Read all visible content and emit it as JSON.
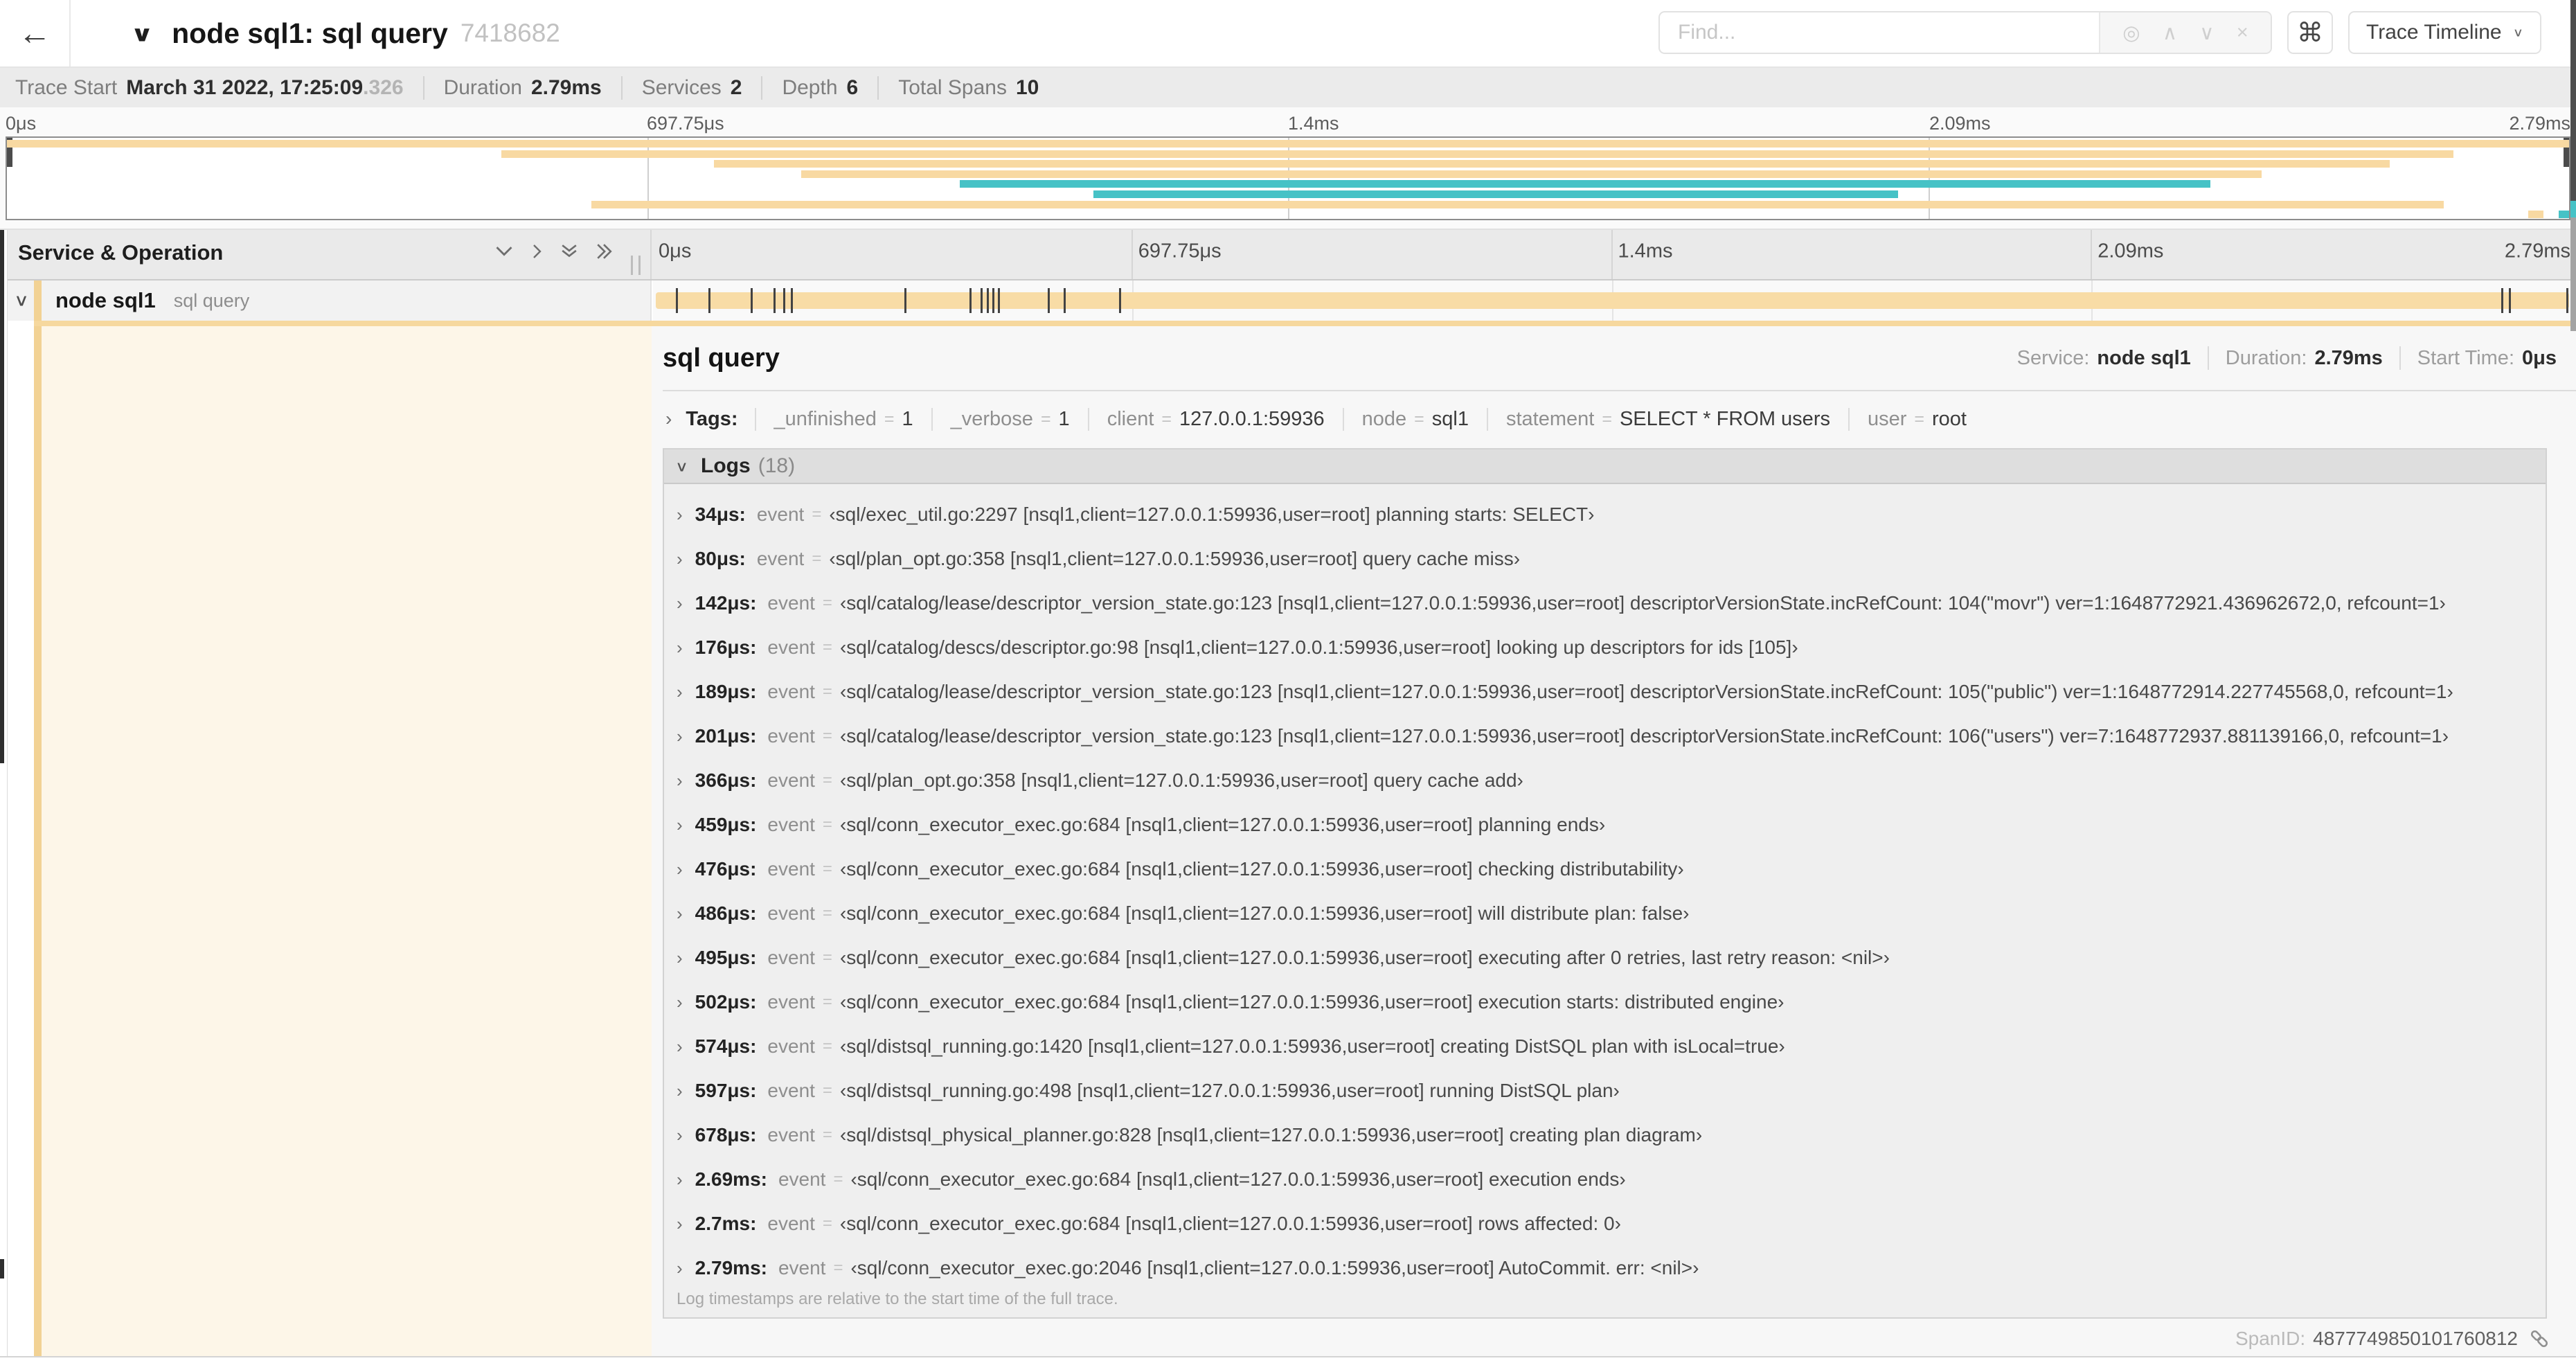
{
  "header": {
    "back_icon": "←",
    "collapse_icon": "∨",
    "title": "node sql1: sql query",
    "trace_id": "7418682",
    "find_placeholder": "Find...",
    "find_icons": [
      "◎",
      "∧",
      "∨",
      "×"
    ],
    "shortcut_icon": "⌘",
    "view_selector": "Trace Timeline",
    "view_chevron": "∨"
  },
  "summary": {
    "items": [
      {
        "label": "Trace Start",
        "value": "March 31 2022, 17:25:09",
        "suffix": ".326"
      },
      {
        "label": "Duration",
        "value": "2.79ms"
      },
      {
        "label": "Services",
        "value": "2"
      },
      {
        "label": "Depth",
        "value": "6"
      },
      {
        "label": "Total Spans",
        "value": "10"
      }
    ]
  },
  "minimap": {
    "ticks": [
      "0μs",
      "697.75μs",
      "1.4ms",
      "2.09ms",
      "2.79ms"
    ],
    "bars": [
      {
        "row": 0,
        "color": "tan",
        "start": 0,
        "end": 100
      },
      {
        "row": 1,
        "color": "tan",
        "start": 19.3,
        "end": 95.5
      },
      {
        "row": 2,
        "color": "tan",
        "start": 27.6,
        "end": 93.0
      },
      {
        "row": 3,
        "color": "tan",
        "start": 31.0,
        "end": 88.0
      },
      {
        "row": 4,
        "color": "teal",
        "start": 37.2,
        "end": 86.0
      },
      {
        "row": 5,
        "color": "teal",
        "start": 42.4,
        "end": 73.8
      },
      {
        "row": 6,
        "color": "tan",
        "start": 22.8,
        "end": 95.1
      },
      {
        "row": 7,
        "color": "tan",
        "start": 98.4,
        "end": 99.0
      },
      {
        "row": 7,
        "color": "teal",
        "start": 99.6,
        "end": 100
      }
    ]
  },
  "timeline": {
    "left_header": "Service & Operation",
    "axis_ticks": [
      "0μs",
      "697.75μs",
      "1.4ms",
      "2.09ms",
      "2.79ms"
    ],
    "row_chevron": "∨",
    "row": {
      "service": "node sql1",
      "operation": "sql query"
    },
    "log_marker_pcts": [
      1.2,
      2.9,
      5.1,
      6.3,
      6.8,
      7.2,
      13.1,
      16.5,
      17.1,
      17.4,
      17.7,
      18.0,
      20.6,
      21.4,
      24.3,
      96.4,
      96.8,
      99.8
    ]
  },
  "detail": {
    "title": "sql query",
    "meta": [
      {
        "label": "Service:",
        "value": "node sql1"
      },
      {
        "label": "Duration:",
        "value": "2.79ms"
      },
      {
        "label": "Start Time:",
        "value": "0μs"
      }
    ],
    "tags_chevron": "›",
    "tags_label": "Tags:",
    "tags": [
      {
        "key": "_unfinished",
        "value": "1"
      },
      {
        "key": "_verbose",
        "value": "1"
      },
      {
        "key": "client",
        "value": "127.0.0.1:59936"
      },
      {
        "key": "node",
        "value": "sql1"
      },
      {
        "key": "statement",
        "value": "SELECT * FROM users"
      },
      {
        "key": "user",
        "value": "root"
      }
    ],
    "logs_chevron": "∨",
    "logs_label": "Logs",
    "logs_count": "(18)",
    "row_chevron": "›",
    "log_field_key": "event",
    "logs": [
      {
        "time": "34μs:",
        "value": "‹sql/exec_util.go:2297 [nsql1,client=127.0.0.1:59936,user=root] planning starts: SELECT›"
      },
      {
        "time": "80μs:",
        "value": "‹sql/plan_opt.go:358 [nsql1,client=127.0.0.1:59936,user=root] query cache miss›"
      },
      {
        "time": "142μs:",
        "value": "‹sql/catalog/lease/descriptor_version_state.go:123 [nsql1,client=127.0.0.1:59936,user=root] descriptorVersionState.incRefCount: 104(\"movr\") ver=1:1648772921.436962672,0, refcount=1›"
      },
      {
        "time": "176μs:",
        "value": "‹sql/catalog/descs/descriptor.go:98 [nsql1,client=127.0.0.1:59936,user=root] looking up descriptors for ids [105]›"
      },
      {
        "time": "189μs:",
        "value": "‹sql/catalog/lease/descriptor_version_state.go:123 [nsql1,client=127.0.0.1:59936,user=root] descriptorVersionState.incRefCount: 105(\"public\") ver=1:1648772914.227745568,0, refcount=1›"
      },
      {
        "time": "201μs:",
        "value": "‹sql/catalog/lease/descriptor_version_state.go:123 [nsql1,client=127.0.0.1:59936,user=root] descriptorVersionState.incRefCount: 106(\"users\") ver=7:1648772937.881139166,0, refcount=1›"
      },
      {
        "time": "366μs:",
        "value": "‹sql/plan_opt.go:358 [nsql1,client=127.0.0.1:59936,user=root] query cache add›"
      },
      {
        "time": "459μs:",
        "value": "‹sql/conn_executor_exec.go:684 [nsql1,client=127.0.0.1:59936,user=root] planning ends›"
      },
      {
        "time": "476μs:",
        "value": "‹sql/conn_executor_exec.go:684 [nsql1,client=127.0.0.1:59936,user=root] checking distributability›"
      },
      {
        "time": "486μs:",
        "value": "‹sql/conn_executor_exec.go:684 [nsql1,client=127.0.0.1:59936,user=root] will distribute plan: false›"
      },
      {
        "time": "495μs:",
        "value": "‹sql/conn_executor_exec.go:684 [nsql1,client=127.0.0.1:59936,user=root] executing after 0 retries, last retry reason: <nil>›"
      },
      {
        "time": "502μs:",
        "value": "‹sql/conn_executor_exec.go:684 [nsql1,client=127.0.0.1:59936,user=root] execution starts: distributed engine›"
      },
      {
        "time": "574μs:",
        "value": "‹sql/distsql_running.go:1420 [nsql1,client=127.0.0.1:59936,user=root] creating DistSQL plan with isLocal=true›"
      },
      {
        "time": "597μs:",
        "value": "‹sql/distsql_running.go:498 [nsql1,client=127.0.0.1:59936,user=root] running DistSQL plan›"
      },
      {
        "time": "678μs:",
        "value": "‹sql/distsql_physical_planner.go:828 [nsql1,client=127.0.0.1:59936,user=root] creating plan diagram›"
      },
      {
        "time": "2.69ms:",
        "value": "‹sql/conn_executor_exec.go:684 [nsql1,client=127.0.0.1:59936,user=root] execution ends›"
      },
      {
        "time": "2.7ms:",
        "value": "‹sql/conn_executor_exec.go:684 [nsql1,client=127.0.0.1:59936,user=root] rows affected: 0›"
      },
      {
        "time": "2.79ms:",
        "value": "‹sql/conn_executor_exec.go:2046 [nsql1,client=127.0.0.1:59936,user=root] AutoCommit. err: <nil>›"
      }
    ],
    "logs_footer": "Log timestamps are relative to the start time of the full trace.",
    "span_id_label": "SpanID:",
    "span_id": "4877749850101760812"
  },
  "colors": {
    "tan": "#f8d9a2",
    "teal": "#46c2c6",
    "stripe": "#f2d294",
    "accent": "#f6d89e",
    "cream": "#fdf6e8",
    "bar": "#f8dca6"
  }
}
